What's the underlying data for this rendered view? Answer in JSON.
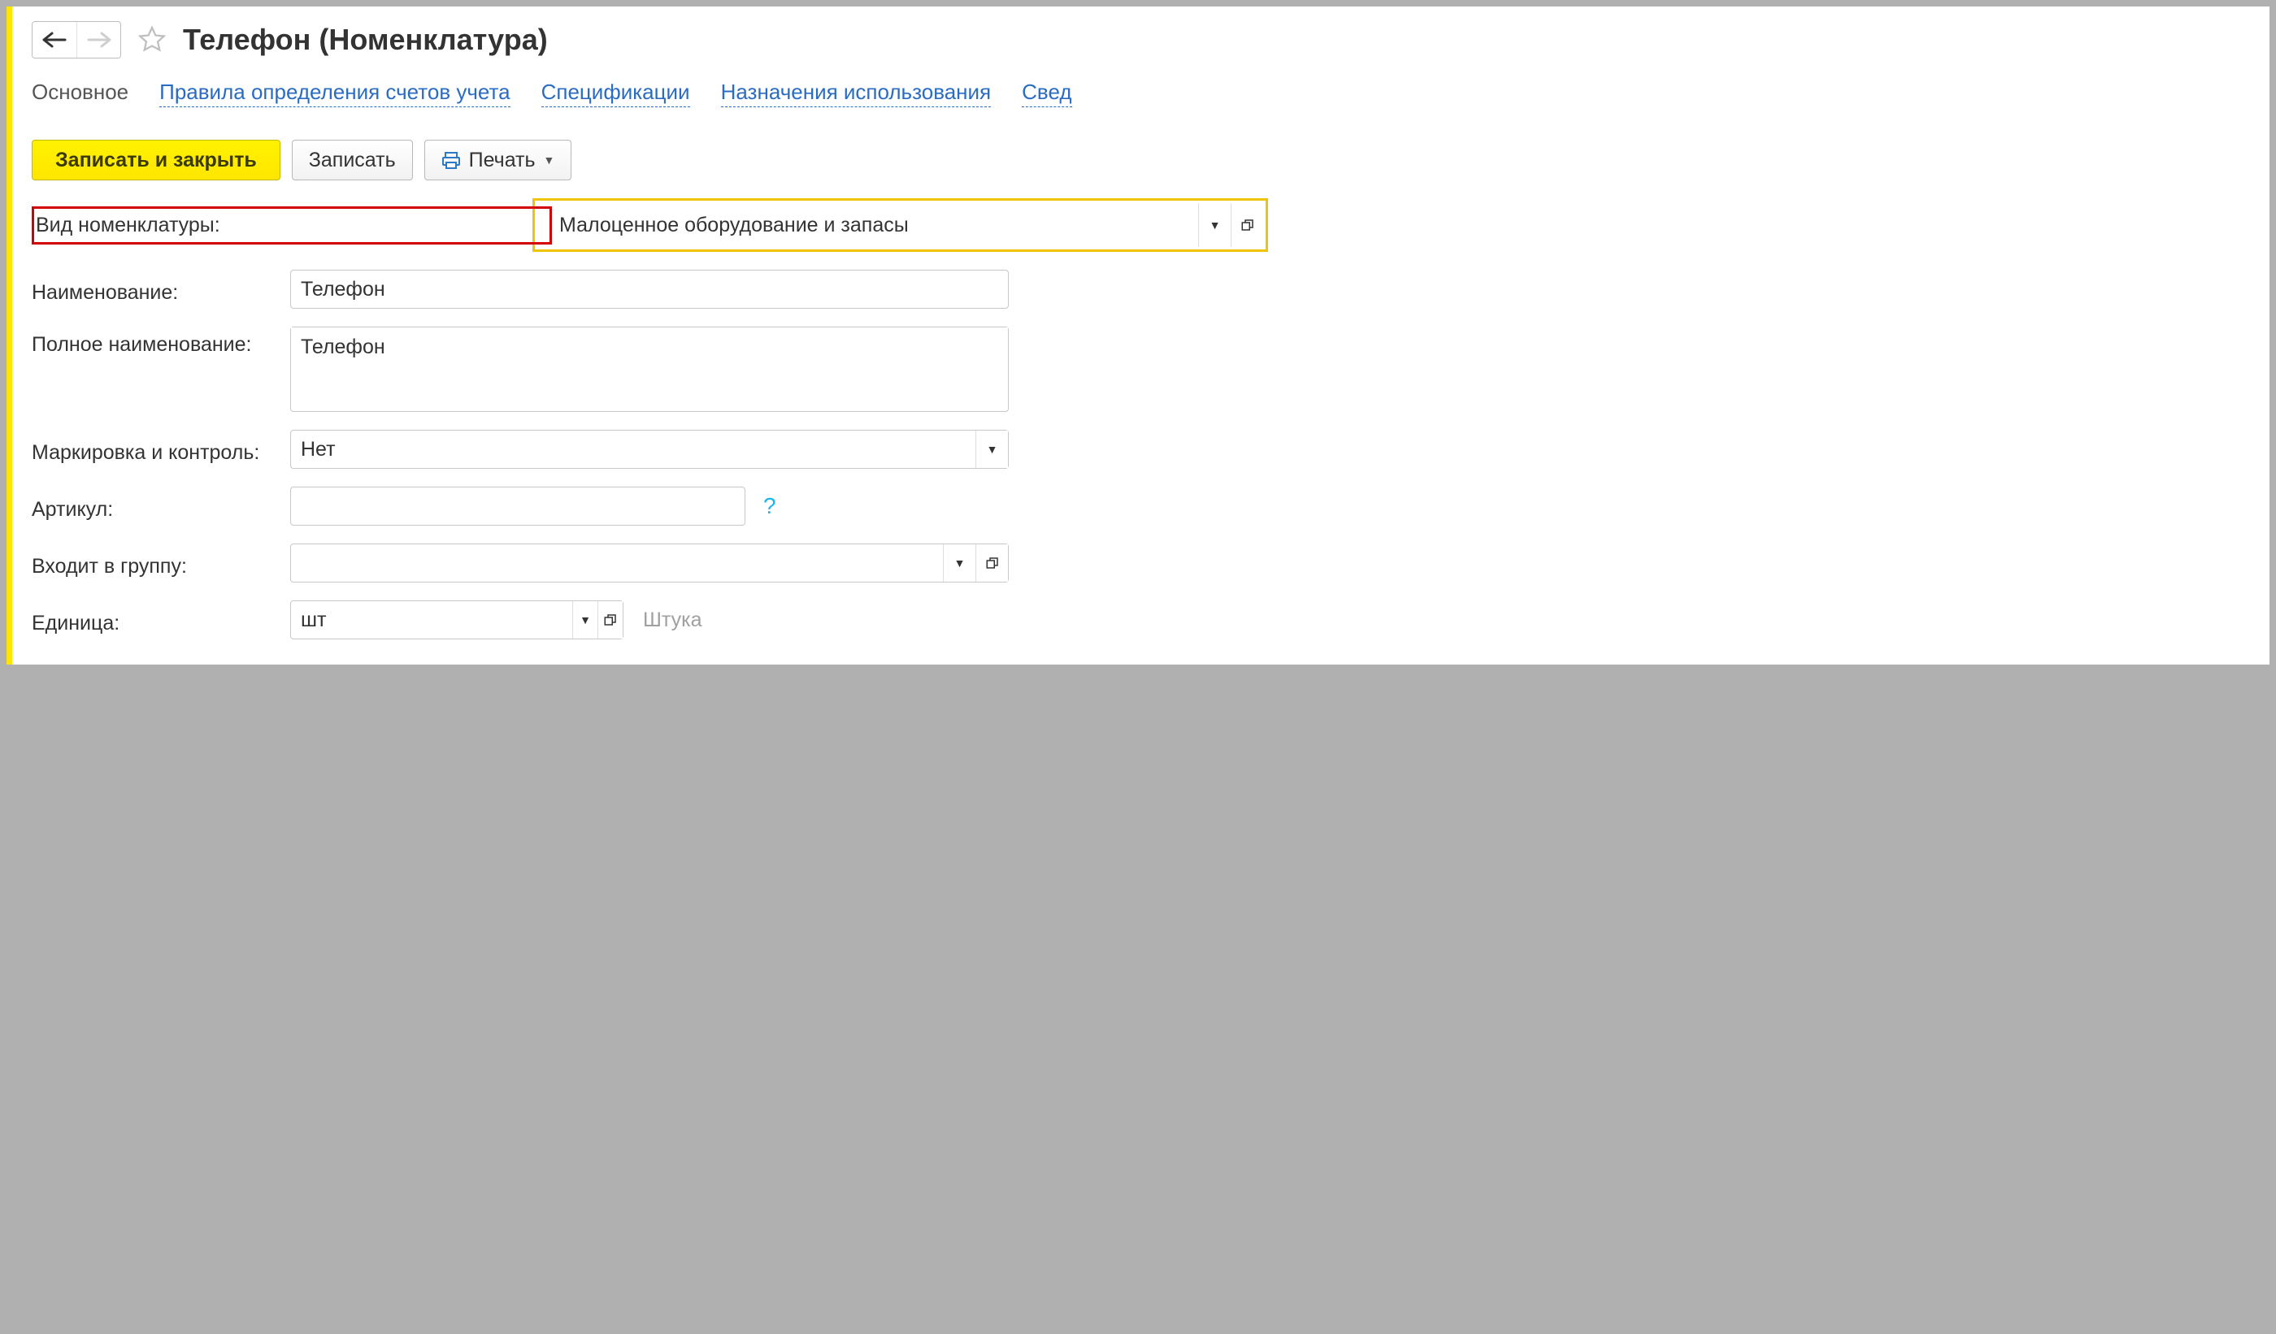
{
  "header": {
    "title": "Телефон (Номенклатура)"
  },
  "tabs": {
    "main": "Основное",
    "rules": "Правила определения счетов учета",
    "specs": "Спецификации",
    "usage": "Назначения использования",
    "info": "Свед"
  },
  "toolbar": {
    "save_close": "Записать и закрыть",
    "save": "Записать",
    "print": "Печать"
  },
  "form": {
    "type_label": "Вид номенклатуры:",
    "type_value": "Малоценное оборудование и запасы",
    "name_label": "Наименование:",
    "name_value": "Телефон",
    "fullname_label": "Полное наименование:",
    "fullname_value": "Телефон",
    "marking_label": "Маркировка и контроль:",
    "marking_value": "Нет",
    "article_label": "Артикул:",
    "article_value": "",
    "article_help": "?",
    "group_label": "Входит в группу:",
    "group_value": "",
    "unit_label": "Единица:",
    "unit_value": "шт",
    "unit_desc": "Штука"
  }
}
